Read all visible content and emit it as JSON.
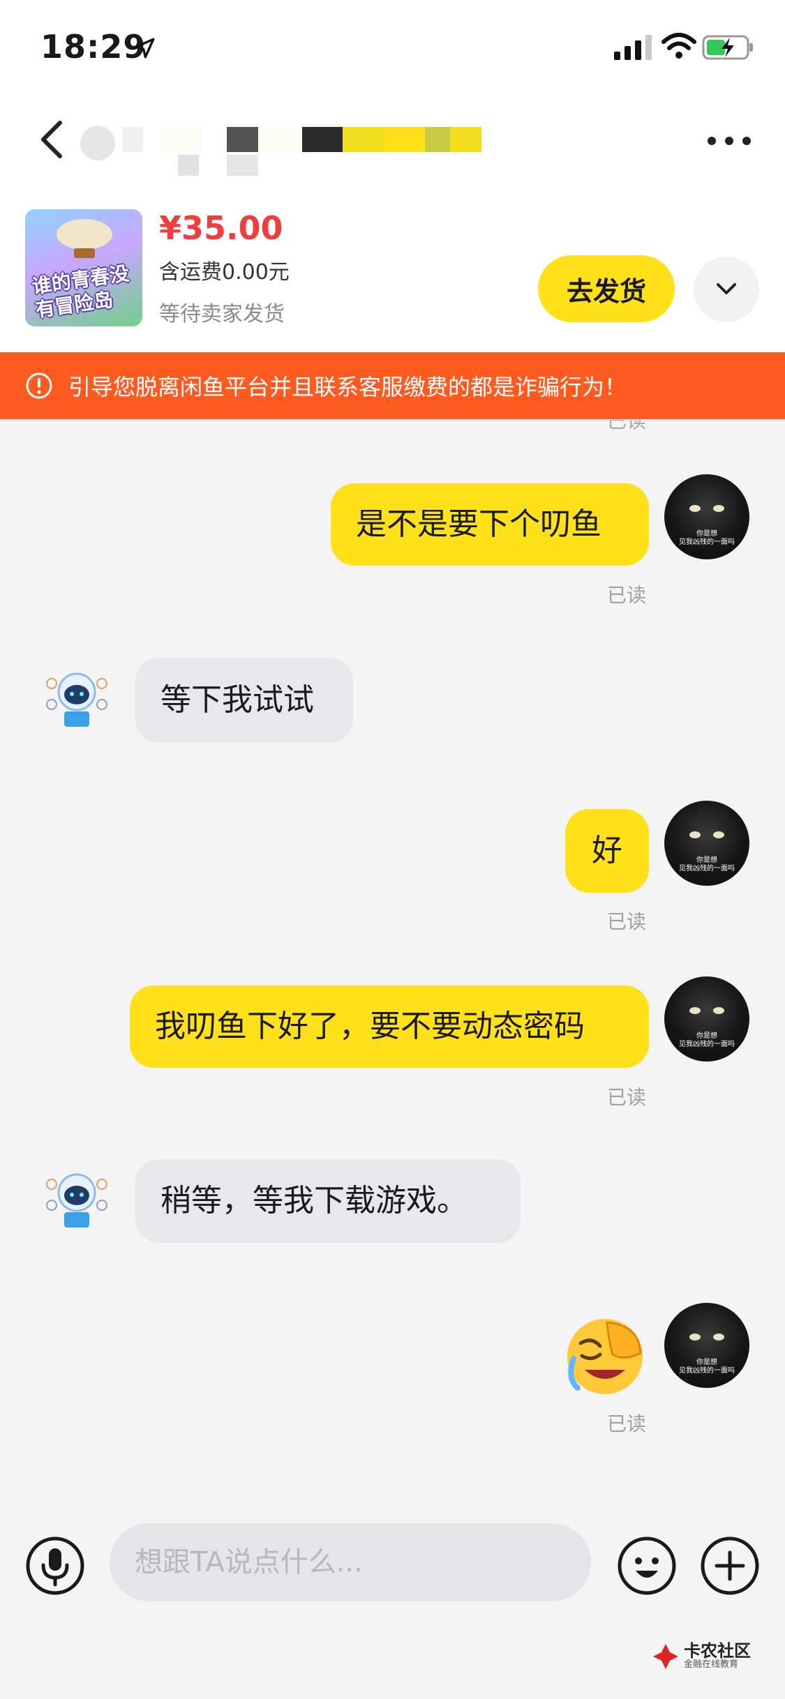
{
  "status_bar": {
    "time": "18:29"
  },
  "order": {
    "thumbnail_text": "谁的青春没有冒险岛",
    "price": "¥35.00",
    "shipping": "含运费0.00元",
    "status": "等待卖家发货",
    "ship_button": "去发货"
  },
  "warning": {
    "text": "引导您脱离闲鱼平台并且联系客服缴费的都是诈骗行为！"
  },
  "messages": [
    {
      "side": "me",
      "text": "是不是要下个叨鱼",
      "read": "已读"
    },
    {
      "side": "them",
      "text": "等下我试试"
    },
    {
      "side": "me",
      "text": "好",
      "read": "已读"
    },
    {
      "side": "me",
      "text": "我叨鱼下好了，要不要动态密码",
      "read": "已读"
    },
    {
      "side": "them",
      "text": "稍等，等我下载游戏。"
    },
    {
      "side": "me",
      "emoji": "facepalm-crying-emoji",
      "read": "已读"
    }
  ],
  "top_read_partial": "已读",
  "avatar_caption": [
    "你是想",
    "见我凶残的一面吗"
  ],
  "input": {
    "placeholder": "想跟TA说点什么..."
  },
  "watermark": {
    "title": "卡农社区",
    "subtitle": "金融在线教育"
  },
  "colors": {
    "accent": "#ffe11a",
    "warning": "#ff5a1f",
    "price": "#f03d3d"
  }
}
